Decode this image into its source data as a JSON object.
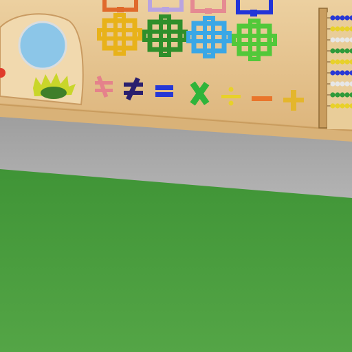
{
  "scene": {
    "wall_board": {
      "top_row": [
        {
          "icon": "frame-orange-icon",
          "color": "#e06a2c"
        },
        {
          "icon": "frame-lavender-icon",
          "color": "#b9a4e0"
        },
        {
          "icon": "frame-pink-icon",
          "color": "#e58a92"
        },
        {
          "icon": "frame-blue-icon",
          "color": "#2234d8"
        }
      ],
      "middle_row": [
        {
          "icon": "frame-yellow-icon",
          "color": "#e8b21a"
        },
        {
          "icon": "frame-green-icon",
          "color": "#2f8f2b"
        },
        {
          "icon": "frame-lightblue-icon",
          "color": "#3aa7e6"
        },
        {
          "icon": "frame-lime-icon",
          "color": "#52c83a"
        }
      ],
      "math_symbols": [
        {
          "icon": "not-equal-pink-icon",
          "color": "#e5828b"
        },
        {
          "icon": "not-equal-indigo-icon",
          "color": "#2a1f6e"
        },
        {
          "icon": "equal-blue-icon",
          "color": "#2638d6"
        },
        {
          "icon": "multiply-green-icon",
          "color": "#2fb43a"
        },
        {
          "icon": "divide-yellow-icon",
          "color": "#e8d12a"
        },
        {
          "icon": "minus-orange-icon",
          "color": "#e9752b"
        },
        {
          "icon": "plus-gold-icon",
          "color": "#e4b62c"
        }
      ],
      "dial": {
        "icon": "magnifier-mirror-icon",
        "color": "#8cc6e8"
      },
      "sun": {
        "icon": "sun-yellow-icon",
        "color": "#c9d62a"
      },
      "abacus": {
        "icon": "abacus-icon",
        "bead_rows": [
          "#2838d6",
          "#e8d12a",
          "#e7e7e7",
          "#2f9a3a",
          "#e8d12a",
          "#2838d6",
          "#e7e7e7",
          "#2f9a3a",
          "#e8d12a"
        ]
      }
    },
    "colors": {
      "wood": "#e6c48e",
      "wall": "#a7a7a7",
      "floor": "#4a9a3e"
    }
  }
}
